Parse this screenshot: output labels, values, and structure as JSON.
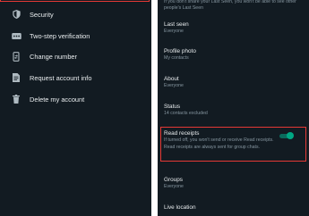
{
  "left_menu": {
    "items": [
      {
        "label": "Security",
        "icon": "shield-icon"
      },
      {
        "label": "Two-step verification",
        "icon": "dots-icon"
      },
      {
        "label": "Change number",
        "icon": "phone-change-icon"
      },
      {
        "label": "Request account info",
        "icon": "document-icon"
      },
      {
        "label": "Delete my account",
        "icon": "trash-icon"
      }
    ]
  },
  "privacy": {
    "last_seen_note": "If you don't share your Last Seen, you won't be able to see other people's Last Seen",
    "last_seen": {
      "title": "Last seen",
      "value": "Everyone"
    },
    "profile_photo": {
      "title": "Profile photo",
      "value": "My contacts"
    },
    "about": {
      "title": "About",
      "value": "Everyone"
    },
    "status": {
      "title": "Status",
      "value": "14 contacts excluded"
    },
    "read_receipts": {
      "title": "Read receipts",
      "description": "If turned off, you won't send or receive Read receipts. Read receipts are always sent for group chats.",
      "enabled": true
    },
    "groups": {
      "title": "Groups",
      "value": "Everyone"
    },
    "live_location": {
      "title": "Live location"
    }
  },
  "colors": {
    "background": "#121b22",
    "accent": "#00a884",
    "highlight": "#e53935",
    "primary_text": "#e9edef",
    "secondary_text": "#8696a0"
  }
}
